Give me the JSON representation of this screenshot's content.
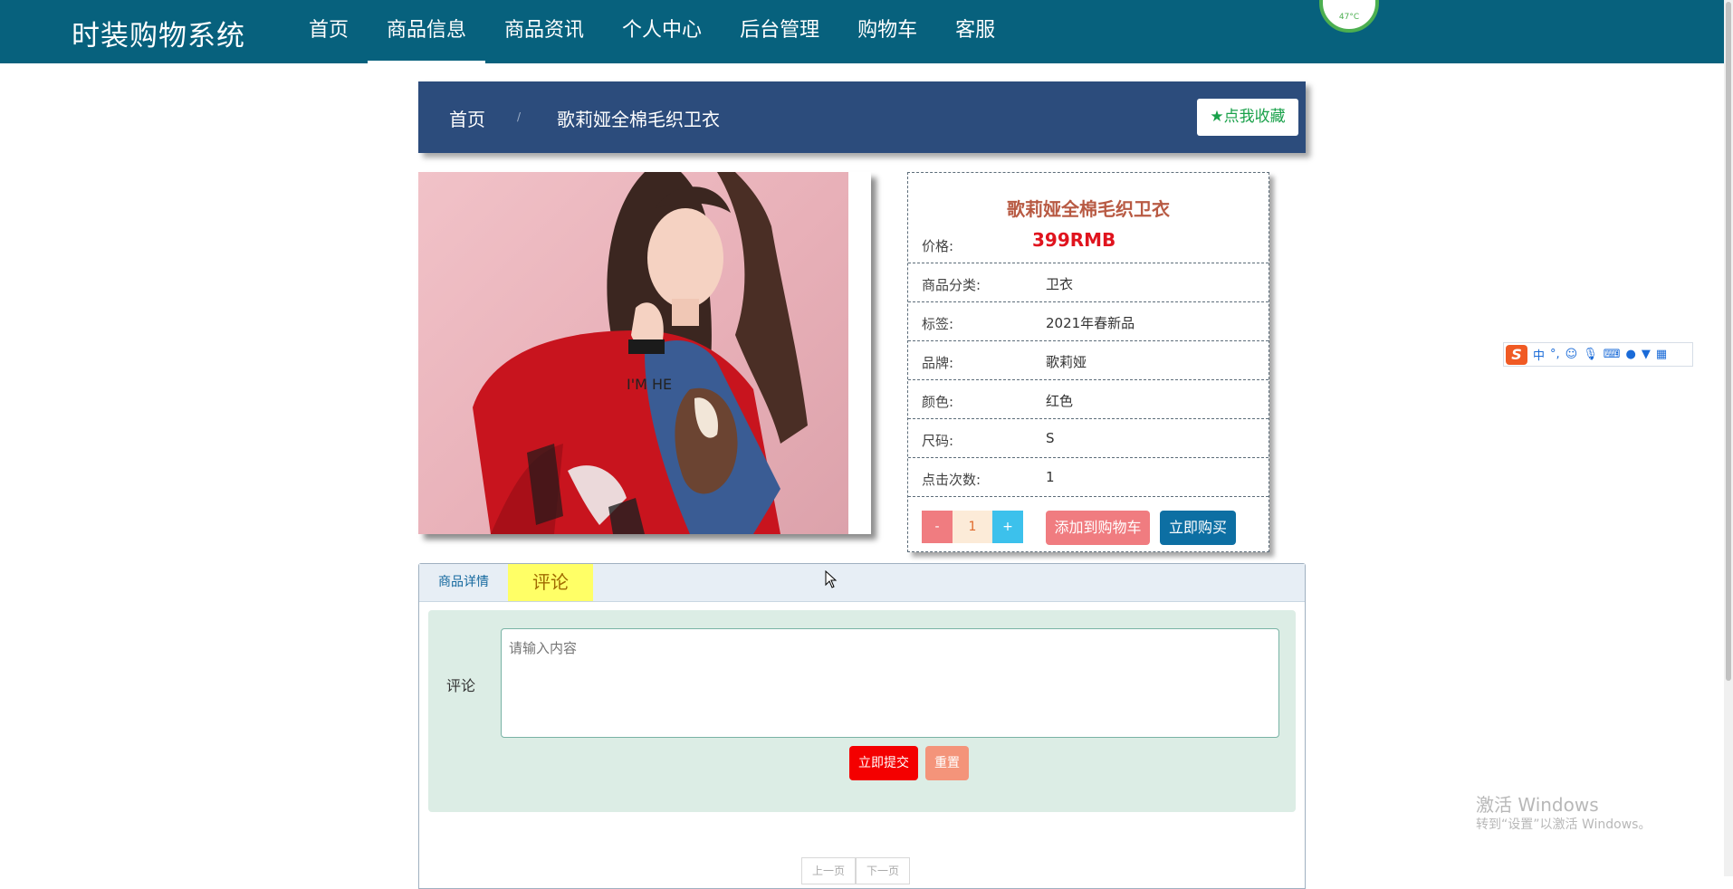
{
  "brand": "时装购物系统",
  "nav": {
    "items": [
      {
        "label": "首页"
      },
      {
        "label": "商品信息",
        "active": true
      },
      {
        "label": "商品资讯"
      },
      {
        "label": "个人中心"
      },
      {
        "label": "后台管理"
      },
      {
        "label": "购物车"
      },
      {
        "label": "客服"
      }
    ]
  },
  "system_widget": {
    "temperature": "47°C"
  },
  "breadcrumb": {
    "home": "首页",
    "separator": "/",
    "current": "歌莉娅全棉毛织卫衣",
    "favorite_label": "点我收藏"
  },
  "product": {
    "title": "歌莉娅全棉毛织卫衣",
    "price_label": "价格:",
    "price": "399RMB",
    "fields": [
      {
        "label": "商品分类:",
        "value": "卫衣"
      },
      {
        "label": "标签:",
        "value": "2021年春新品"
      },
      {
        "label": "品牌:",
        "value": "歌莉娅"
      },
      {
        "label": "颜色:",
        "value": "红色"
      },
      {
        "label": "尺码:",
        "value": "S"
      },
      {
        "label": "点击次数:",
        "value": "1"
      }
    ],
    "quantity": {
      "minus": "-",
      "value": "1",
      "plus": "+"
    },
    "add_to_cart": "添加到购物车",
    "buy_now": "立即购买"
  },
  "tabs": {
    "detail": "商品详情",
    "comment": "评论",
    "active": "comment"
  },
  "comment_form": {
    "label": "评论",
    "placeholder": "请输入内容",
    "submit": "立即提交",
    "reset": "重置"
  },
  "pager": {
    "prev": "上一页",
    "next": "下一页"
  },
  "ime": {
    "logo": "S",
    "mode": "中",
    "punct": "°,"
  },
  "watermark": {
    "title": "激活 Windows",
    "subtitle": "转到“设置”以激活 Windows。"
  },
  "colors": {
    "nav_bg": "#07617d",
    "breadcrumb_bg": "#2c4c7c",
    "price": "#e0141e",
    "title": "#b85a43",
    "submit": "#f40000",
    "buy": "#0d6fa3",
    "cart": "#f07c80"
  }
}
